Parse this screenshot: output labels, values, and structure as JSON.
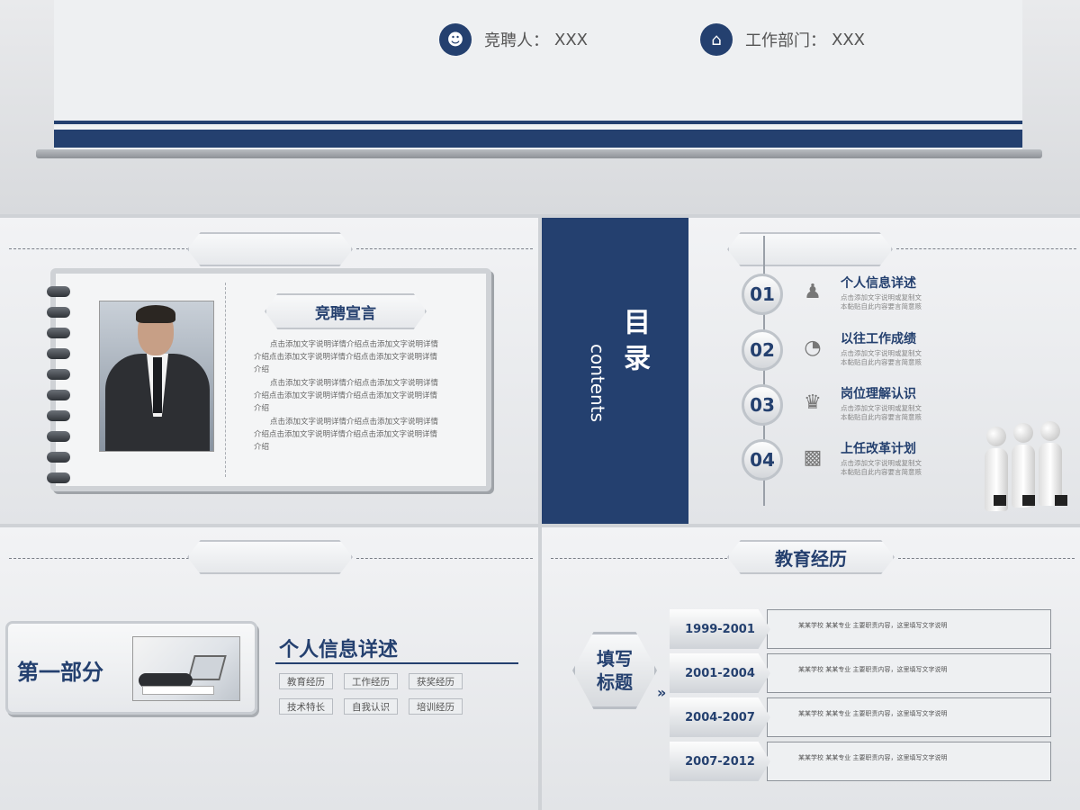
{
  "top": {
    "candidate_label": "竞聘人：",
    "candidate_value": "XXX",
    "department_label": "工作部门：",
    "department_value": "XXX",
    "candidate_icon": "person-icon",
    "department_icon": "home-icon"
  },
  "declaration": {
    "title": "竞聘宣言",
    "paragraphs": [
      "点击添加文字说明详情介绍点击添加文字说明详情介绍点击添加文字说明详情介绍点击添加文字说明详情介绍",
      "点击添加文字说明详情介绍点击添加文字说明详情介绍点击添加文字说明详情介绍点击添加文字说明详情介绍",
      "点击添加文字说明详情介绍点击添加文字说明详情介绍点击添加文字说明详情介绍点击添加文字说明详情介绍"
    ]
  },
  "contents": {
    "title": "目录",
    "title_en": "contents",
    "items": [
      {
        "num": "01",
        "title": "个人信息详述",
        "desc": "点击添加文字说明或复制文本黏贴自此内容要言简意赅",
        "icon": "person-icon"
      },
      {
        "num": "02",
        "title": "以往工作成绩",
        "desc": "点击添加文字说明或复制文本黏贴自此内容要言简意赅",
        "icon": "pie-chart-icon"
      },
      {
        "num": "03",
        "title": "岗位理解认识",
        "desc": "点击添加文字说明或复制文本黏贴自此内容要言简意赅",
        "icon": "presenter-icon"
      },
      {
        "num": "04",
        "title": "上任改革计划",
        "desc": "点击添加文字说明或复制文本黏贴自此内容要言简意赅",
        "icon": "bar-chart-icon"
      }
    ]
  },
  "section": {
    "part": "第一部分",
    "title": "个人信息详述",
    "tags": [
      "教育经历",
      "工作经历",
      "获奖经历",
      "技术特长",
      "自我认识",
      "培训经历"
    ]
  },
  "education": {
    "title": "教育经历",
    "side_label_1": "填写",
    "side_label_2": "标题",
    "rows": [
      {
        "years": "1999-2001",
        "text": "某某学校  某某专业  主要职责内容，这里填写文字说明"
      },
      {
        "years": "2001-2004",
        "text": "某某学校  某某专业  主要职责内容，这里填写文字说明"
      },
      {
        "years": "2004-2007",
        "text": "某某学校  某某专业  主要职责内容，这里填写文字说明"
      },
      {
        "years": "2007-2012",
        "text": "某某学校  某某专业  主要职责内容，这里填写文字说明"
      }
    ]
  }
}
